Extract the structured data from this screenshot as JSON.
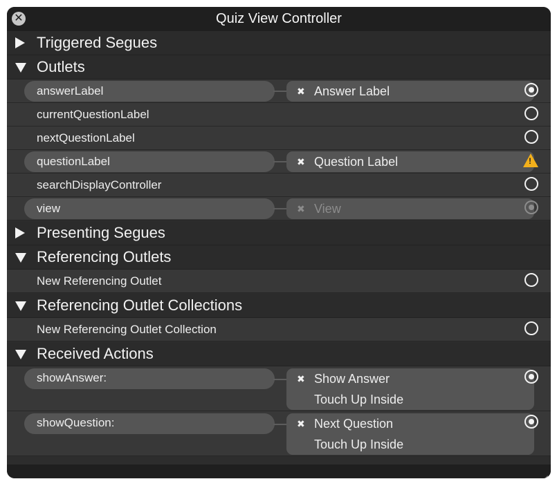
{
  "window": {
    "title": "Quiz View Controller"
  },
  "sections": {
    "triggered_segues": "Triggered Segues",
    "outlets": "Outlets",
    "presenting_segues": "Presenting Segues",
    "referencing_outlets": "Referencing Outlets",
    "referencing_outlet_collections": "Referencing Outlet Collections",
    "received_actions": "Received Actions"
  },
  "outlets": [
    {
      "name": "answerLabel",
      "target": "Answer Label",
      "status": "connected"
    },
    {
      "name": "currentQuestionLabel",
      "target": "",
      "status": "empty"
    },
    {
      "name": "nextQuestionLabel",
      "target": "",
      "status": "empty"
    },
    {
      "name": "questionLabel",
      "target": "Question Label",
      "status": "warning"
    },
    {
      "name": "searchDisplayController",
      "target": "",
      "status": "empty"
    },
    {
      "name": "view",
      "target": "View",
      "status": "connected-disabled"
    }
  ],
  "referencing_outlets": {
    "new_label": "New Referencing Outlet"
  },
  "referencing_outlet_collections": {
    "new_label": "New Referencing Outlet Collection"
  },
  "actions": [
    {
      "name": "showAnswer:",
      "target": "Show Answer",
      "event": "Touch Up Inside"
    },
    {
      "name": "showQuestion:",
      "target": "Next Question",
      "event": "Touch Up Inside"
    }
  ],
  "glyphs": {
    "close": "✕",
    "remove": "✖",
    "warning": "!"
  },
  "icons": [
    "close-icon",
    "disclosure-triangle-icon",
    "remove-connection-icon",
    "connection-circle-icon",
    "warning-icon",
    "resize-grip-icon"
  ],
  "colors": {
    "panel_bg": "#2d2d2d",
    "row_bg": "#383838",
    "pill_bg": "#555555",
    "warning": "#f3b01b"
  }
}
